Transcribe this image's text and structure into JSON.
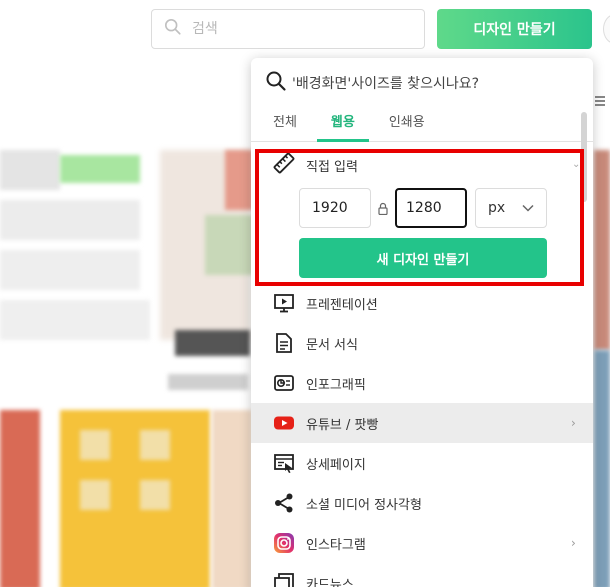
{
  "header": {
    "search_placeholder": "검색",
    "make_button": "디자인 만들기"
  },
  "dropdown": {
    "query_text": "'배경화면'사이즈를 찾으시나요?",
    "tabs": [
      {
        "label": "전체",
        "active": false
      },
      {
        "label": "웹용",
        "active": true
      },
      {
        "label": "인쇄용",
        "active": false
      }
    ],
    "custom": {
      "title": "직접 입력",
      "width_value": "1920",
      "height_value": "1280",
      "unit": "px",
      "create_button": "새 디자인 만들기"
    },
    "items": [
      {
        "label": "프레젠테이션",
        "icon": "presentation-icon"
      },
      {
        "label": "문서 서식",
        "icon": "document-icon"
      },
      {
        "label": "인포그래픽",
        "icon": "infographic-icon"
      },
      {
        "label": "유튜브 / 팟빵",
        "icon": "youtube-icon",
        "has_submenu": true,
        "hovered": true
      },
      {
        "label": "상세페이지",
        "icon": "detail-page-icon"
      },
      {
        "label": "소셜 미디어 정사각형",
        "icon": "share-icon"
      },
      {
        "label": "인스타그램",
        "icon": "instagram-icon",
        "has_submenu": true
      },
      {
        "label": "카드뉴스",
        "icon": "card-news-icon"
      }
    ]
  },
  "colors": {
    "accent": "#23c48a",
    "highlight": "#e80000",
    "youtube": "#e62117"
  }
}
